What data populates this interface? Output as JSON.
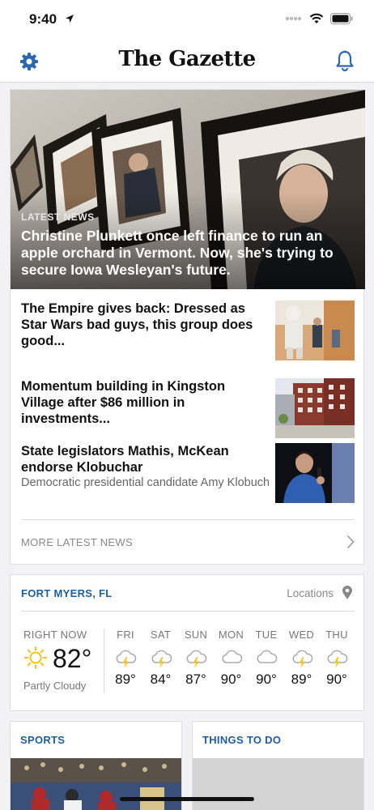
{
  "status_bar": {
    "time": "9:40"
  },
  "header": {
    "logo": "The Gazette"
  },
  "latest_news": {
    "hero": {
      "kicker": "LATEST NEWS",
      "title": "Christine Plunkett once left finance to run an apple orchard in Vermont. Now, she's trying to secure Iowa Wesleyan's future."
    },
    "stories": [
      {
        "title": "The Empire gives back: Dressed as Star Wars bad guys, this group does good...",
        "summary": ""
      },
      {
        "title": "Momentum building in Kingston Village after $86 million in investments...",
        "summary": ""
      },
      {
        "title": "State legislators Mathis, McKean endorse Klobuchar",
        "summary": "Democratic presidential candidate Amy Klobuchar of Minnesota has landed the end..."
      }
    ],
    "more_label": "MORE LATEST NEWS"
  },
  "weather": {
    "city": "FORT MYERS, FL",
    "locations_label": "Locations",
    "now_label": "RIGHT NOW",
    "now_temp": "82°",
    "now_condition": "Partly Cloudy",
    "days": [
      {
        "name": "FRI",
        "icon": "thunderstorm-icon",
        "temp": "89°"
      },
      {
        "name": "SAT",
        "icon": "thunderstorm-icon",
        "temp": "84°"
      },
      {
        "name": "SUN",
        "icon": "thunderstorm-icon",
        "temp": "87°"
      },
      {
        "name": "MON",
        "icon": "cloud-icon",
        "temp": "90°"
      },
      {
        "name": "TUE",
        "icon": "cloud-icon",
        "temp": "90°"
      },
      {
        "name": "WED",
        "icon": "thunderstorm-icon",
        "temp": "89°"
      },
      {
        "name": "THU",
        "icon": "thunderstorm-icon",
        "temp": "90°"
      }
    ]
  },
  "sections": {
    "sports": "SPORTS",
    "things_to_do": "THINGS TO DO"
  },
  "colors": {
    "accent": "#1f5d9e",
    "icon_blue": "#2b68b1",
    "bolt_yellow": "#f2c318"
  }
}
